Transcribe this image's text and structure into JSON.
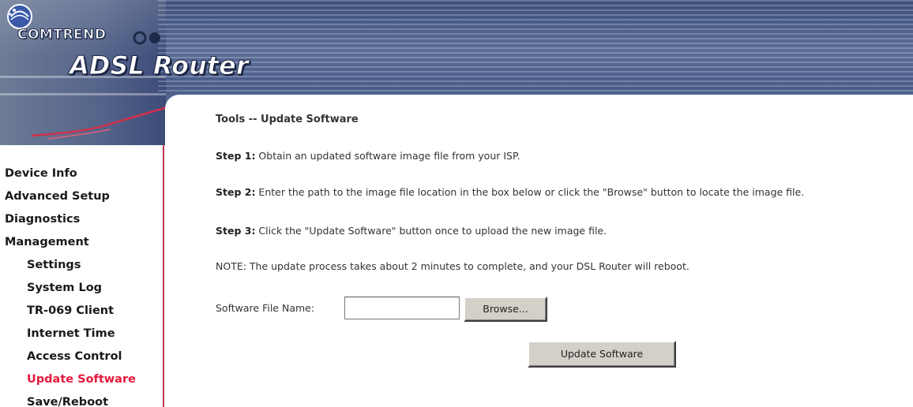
{
  "header": {
    "brand": "COMTREND",
    "product": "ADSL Router"
  },
  "sidebar": {
    "items": [
      {
        "label": "Device Info",
        "level": "top"
      },
      {
        "label": "Advanced Setup",
        "level": "top"
      },
      {
        "label": "Diagnostics",
        "level": "top"
      },
      {
        "label": "Management",
        "level": "top"
      },
      {
        "label": "Settings",
        "level": "sub"
      },
      {
        "label": "System Log",
        "level": "sub"
      },
      {
        "label": "TR-069 Client",
        "level": "sub"
      },
      {
        "label": "Internet Time",
        "level": "sub"
      },
      {
        "label": "Access Control",
        "level": "sub"
      },
      {
        "label": "Update Software",
        "level": "sub",
        "active": true
      },
      {
        "label": "Save/Reboot",
        "level": "sub"
      }
    ],
    "active_color": "#e6193c"
  },
  "main": {
    "title": "Tools -- Update Software",
    "steps": [
      {
        "label": "Step 1:",
        "text": " Obtain an updated software image file from your ISP."
      },
      {
        "label": "Step 2:",
        "text": " Enter the path to the image file location in the box below or click the \"Browse\" button to locate the image file."
      },
      {
        "label": "Step 3:",
        "text": " Click the \"Update Software\" button once to upload the new image file."
      }
    ],
    "note": "NOTE: The update process takes about 2 minutes to complete, and your DSL Router will reboot.",
    "file_label": "Software File Name:",
    "file_value": "",
    "browse_label": "Browse...",
    "update_label": "Update Software"
  },
  "colors": {
    "banner": "#4a5d8a",
    "sidebar_border": "#c0385a",
    "button_face": "#d4d0c8"
  }
}
